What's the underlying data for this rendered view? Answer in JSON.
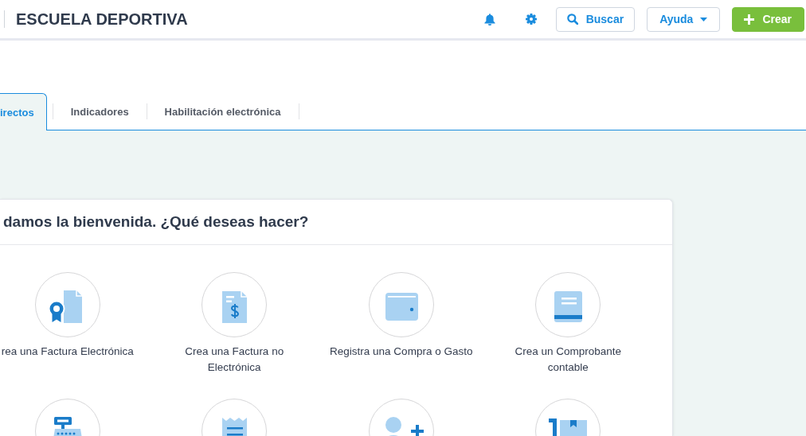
{
  "header": {
    "title": "ESCUELA DEPORTIVA",
    "buttons": [
      {
        "kind": "search",
        "label": "Buscar"
      },
      {
        "kind": "dropdown",
        "label": "Ayuda"
      },
      {
        "kind": "create",
        "label": "Crear"
      }
    ]
  },
  "tabs": [
    {
      "label": "irectos",
      "selected": true
    },
    {
      "label": "Indicadores",
      "selected": false
    },
    {
      "label": "Habilitación electrónica",
      "selected": false
    }
  ],
  "welcome_card": {
    "title": "damos la bienvenida. ¿Qué deseas hacer?",
    "actions": [
      {
        "kind": "electronic-invoice",
        "label": "rea una Factura Electrónica"
      },
      {
        "kind": "invoice",
        "label": "Crea una Factura no Electrónica"
      },
      {
        "kind": "purchase",
        "label": "Registra una Compra o Gasto"
      },
      {
        "kind": "voucher",
        "label": "Crea un Comprobante contable"
      },
      {
        "kind": "pos"
      },
      {
        "kind": "receipt"
      },
      {
        "kind": "contact"
      },
      {
        "kind": "inventory"
      }
    ]
  }
}
